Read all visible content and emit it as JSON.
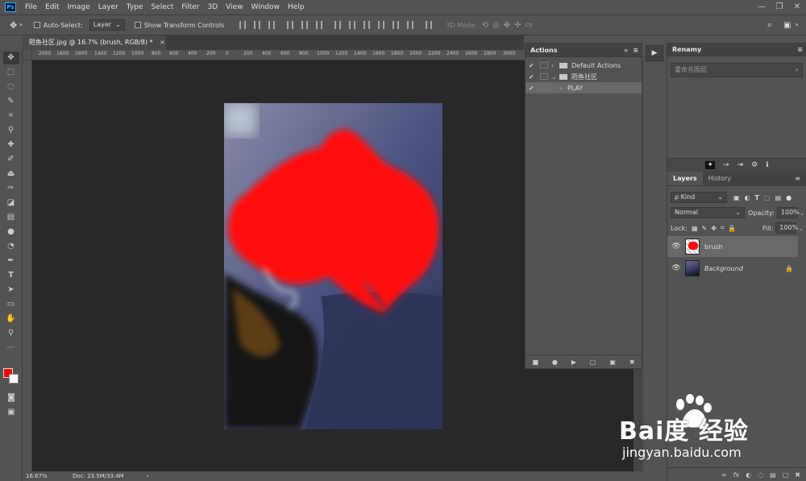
{
  "menubar": {
    "logo": "Ps",
    "items": [
      "File",
      "Edit",
      "Image",
      "Layer",
      "Type",
      "Select",
      "Filter",
      "3D",
      "View",
      "Window",
      "Help"
    ],
    "window_controls": [
      "—",
      "❐",
      "✕"
    ]
  },
  "options": {
    "auto_select_label": "Auto-Select:",
    "auto_select_value": "Layer",
    "show_transform_label": "Show Transform Controls",
    "mode_3d_label": "3D Mode:"
  },
  "document": {
    "tab_title": "陌鱼社区.jpg @ 16.7% (brush, RGB/8) *",
    "close": "×"
  },
  "ruler": {
    "h_labels": [
      "2000",
      "1800",
      "1600",
      "1400",
      "1200",
      "1000",
      "800",
      "600",
      "400",
      "200",
      "0",
      "200",
      "400",
      "600",
      "800",
      "1000",
      "1200",
      "1400",
      "1600",
      "1800",
      "2000",
      "2200",
      "2400",
      "2600",
      "2800",
      "3000"
    ]
  },
  "status": {
    "zoom": "16.67%",
    "doc": "Doc: 23.5M/33.4M",
    "arrow": "›"
  },
  "actions_panel": {
    "title": "Actions",
    "rows": [
      {
        "check": "✔",
        "arrow": "›",
        "label": "Default Actions",
        "folder": true
      },
      {
        "check": "✔",
        "arrow": "⌄",
        "label": "陌鱼社区",
        "folder": true
      },
      {
        "check": "✔",
        "arrow": "›",
        "label": "PLAY",
        "folder": false
      }
    ],
    "bottom_icons": [
      "■",
      "●",
      "▶",
      "▢",
      "▣",
      "✖"
    ]
  },
  "renamy_panel": {
    "title": "Renamy",
    "search_placeholder": "重命名图层",
    "icons": [
      "✦",
      "→",
      "⇥",
      "⚙",
      "ℹ"
    ]
  },
  "layers_panel": {
    "tabs": [
      "Layers",
      "History"
    ],
    "kind": "ρ Kind",
    "blend_mode": "Normal",
    "opacity_label": "Opacity:",
    "opacity_value": "100%",
    "lock_label": "Lock:",
    "fill_label": "Fill:",
    "fill_value": "100%",
    "layers": [
      {
        "name": "brush",
        "visible": true,
        "selected": true
      },
      {
        "name": "Background",
        "visible": true,
        "locked": true
      }
    ],
    "bottom_icons": [
      "∞",
      "fx",
      "◐",
      "◌",
      "▤",
      "▢",
      "✖"
    ]
  },
  "watermark": {
    "logo": "Bai度 经验",
    "url": "jingyan.baidu.com"
  },
  "colors": {
    "foreground": "#ff0000",
    "background": "#ffffff",
    "accent": "#31a8ff"
  }
}
